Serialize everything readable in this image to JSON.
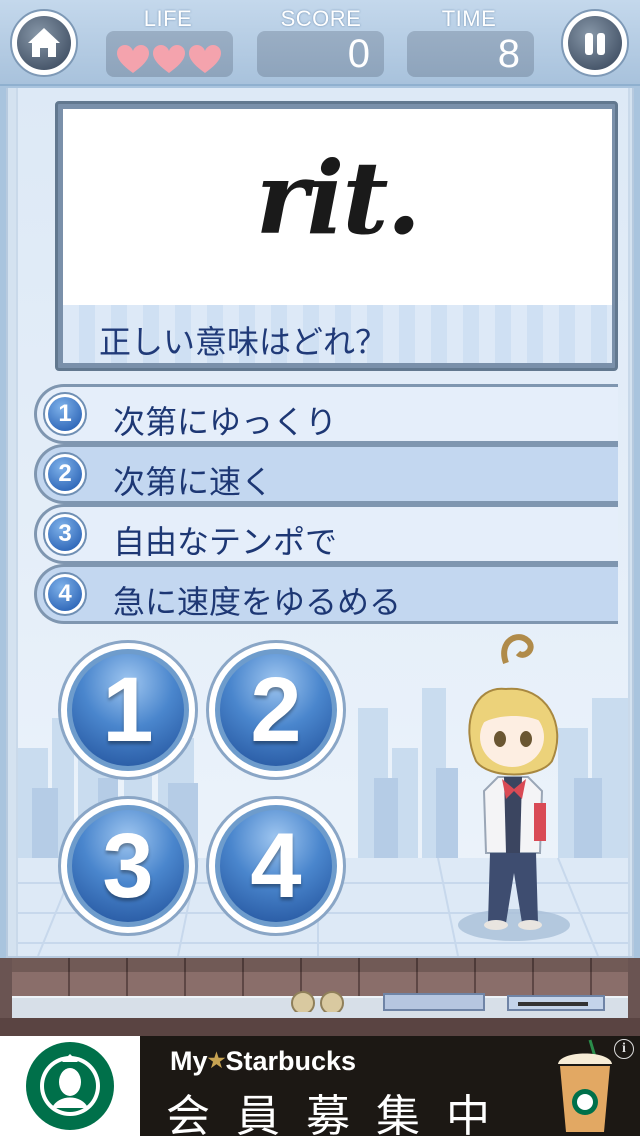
{
  "hud": {
    "life_label": "LIFE",
    "life_value": 3,
    "score_label": "SCORE",
    "score_value": "0",
    "time_label": "TIME",
    "time_value": "8",
    "home_icon": "home-icon",
    "pause_icon": "pause-icon",
    "heart_color": "#f4a3ad"
  },
  "question": {
    "word": "rit.",
    "prompt": "正しい意味はどれ？"
  },
  "choices": [
    {
      "num": "1",
      "text": "次第にゆっくり"
    },
    {
      "num": "2",
      "text": "次第に速く"
    },
    {
      "num": "3",
      "text": "自由なテンポで"
    },
    {
      "num": "4",
      "text": "急に速度をゆるめる"
    }
  ],
  "answer_buttons": [
    "1",
    "2",
    "3",
    "4"
  ],
  "ad": {
    "title_my": "My",
    "title_brand": "Starbucks",
    "subtitle": "会員募集中",
    "info": "i",
    "brand_color": "#00704a"
  }
}
